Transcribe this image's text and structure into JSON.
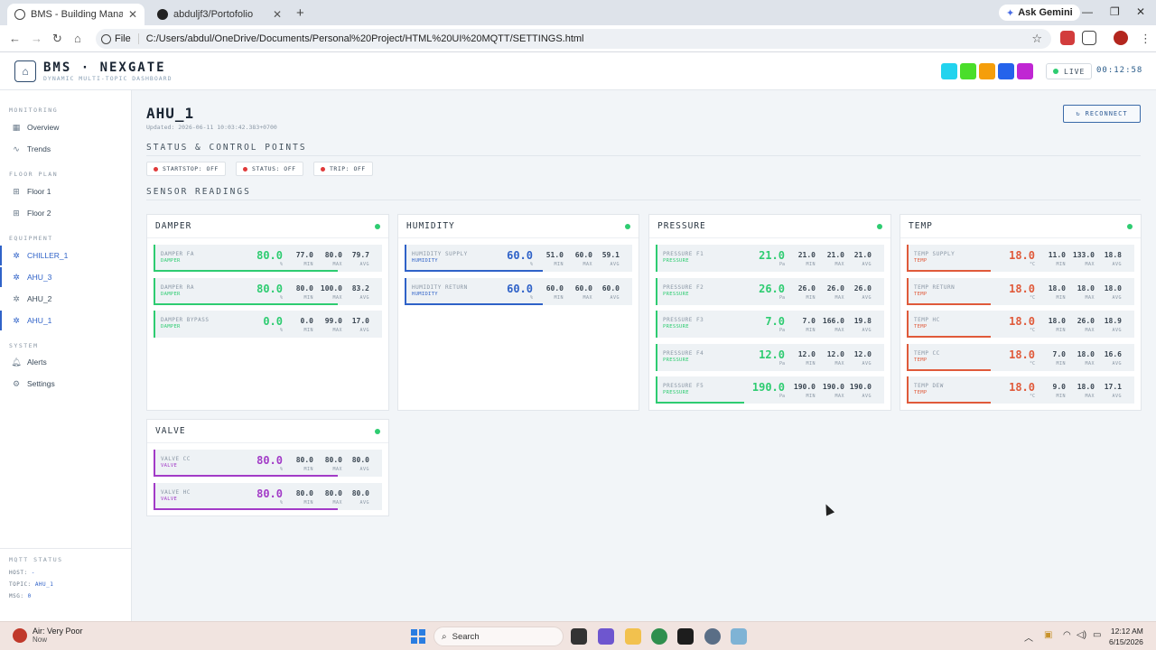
{
  "browser": {
    "tabs": [
      {
        "title": "BMS - Building Management Sy",
        "active": true
      },
      {
        "title": "abduljf3/Portofolio",
        "active": false
      }
    ],
    "ask_gemini": "Ask Gemini",
    "file_chip": "File",
    "url": "C:/Users/abdul/OneDrive/Documents/Personal%20Project/HTML%20UI%20MQTT/SETTINGS.html"
  },
  "header": {
    "brand": "BMS · NEXGATE",
    "subtitle": "DYNAMIC MULTI-TOPIC DASHBOARD",
    "swatches": [
      "#22d3ee",
      "#4ade2a",
      "#f59e0b",
      "#2563eb",
      "#c026d3"
    ],
    "live": "LIVE",
    "clock": "00:12:58"
  },
  "sidebar": {
    "sections": {
      "monitoring": "MONITORING",
      "floor_plan": "FLOOR PLAN",
      "equipment": "EQUIPMENT",
      "system": "SYSTEM"
    },
    "monitoring_items": [
      "Overview",
      "Trends"
    ],
    "floor_items": [
      "Floor 1",
      "Floor 2"
    ],
    "equipment_items": [
      "CHILLER_1",
      "AHU_3",
      "AHU_2",
      "AHU_1"
    ],
    "system_items": [
      "Alerts",
      "Settings"
    ],
    "mqtt": {
      "title": "MQTT STATUS",
      "host_label": "HOST:",
      "host": "-",
      "topic_label": "TOPIC:",
      "topic": "AHU_1",
      "msg_label": "MSG:",
      "msg": "0"
    }
  },
  "main": {
    "title": "AHU_1",
    "updated": "Updated: 2026-06-11 10:03:42.383+0700",
    "reconnect": "RECONNECT",
    "status_title": "STATUS & CONTROL POINTS",
    "status_chips": [
      "STARTSTOP: OFF",
      "STATUS: OFF",
      "TRIP: OFF"
    ],
    "sensor_title": "SENSOR READINGS",
    "stat_labels": {
      "min": "MIN",
      "max": "MAX",
      "avg": "AVG"
    }
  },
  "cards": [
    {
      "title": "DAMPER",
      "color": "#2ecc71",
      "rows": [
        {
          "name": "DAMPER FA",
          "type": "DAMPER",
          "value": "80.0",
          "unit": "%",
          "min": "77.0",
          "max": "80.0",
          "avg": "79.7",
          "level": 0.8
        },
        {
          "name": "DAMPER RA",
          "type": "DAMPER",
          "value": "80.0",
          "unit": "%",
          "min": "80.0",
          "max": "100.0",
          "avg": "83.2",
          "level": 0.8
        },
        {
          "name": "DAMPER BYPASS",
          "type": "DAMPER",
          "value": "0.0",
          "unit": "%",
          "min": "0.0",
          "max": "99.0",
          "avg": "17.0",
          "level": 0.0
        }
      ]
    },
    {
      "title": "HUMIDITY",
      "color": "#2f62c8",
      "rows": [
        {
          "name": "HUMIDITY SUPPLY",
          "type": "HUMIDITY",
          "value": "60.0",
          "unit": "%",
          "min": "51.0",
          "max": "60.0",
          "avg": "59.1",
          "level": 0.6
        },
        {
          "name": "HUMIDITY RETURN",
          "type": "HUMIDITY",
          "value": "60.0",
          "unit": "%",
          "min": "60.0",
          "max": "60.0",
          "avg": "60.0",
          "level": 0.6
        }
      ]
    },
    {
      "title": "PRESSURE",
      "color": "#2ecc71",
      "rows": [
        {
          "name": "PRESSURE F1",
          "type": "PRESSURE",
          "value": "21.0",
          "unit": "Pa",
          "min": "21.0",
          "max": "21.0",
          "avg": "21.0",
          "level": 0.0
        },
        {
          "name": "PRESSURE F2",
          "type": "PRESSURE",
          "value": "26.0",
          "unit": "Pa",
          "min": "26.0",
          "max": "26.0",
          "avg": "26.0",
          "level": 0.0
        },
        {
          "name": "PRESSURE F3",
          "type": "PRESSURE",
          "value": "7.0",
          "unit": "Pa",
          "min": "7.0",
          "max": "166.0",
          "avg": "19.8",
          "level": 0.0
        },
        {
          "name": "PRESSURE F4",
          "type": "PRESSURE",
          "value": "12.0",
          "unit": "Pa",
          "min": "12.0",
          "max": "12.0",
          "avg": "12.0",
          "level": 0.0
        },
        {
          "name": "PRESSURE F5",
          "type": "PRESSURE",
          "value": "190.0",
          "unit": "Pa",
          "min": "190.0",
          "max": "190.0",
          "avg": "190.0",
          "level": 0.38
        }
      ]
    },
    {
      "title": "TEMP",
      "color": "#e05a3a",
      "rows": [
        {
          "name": "TEMP SUPPLY",
          "type": "TEMP",
          "value": "18.0",
          "unit": "°C",
          "min": "11.0",
          "max": "133.0",
          "avg": "18.8",
          "level": 0.36
        },
        {
          "name": "TEMP RETURN",
          "type": "TEMP",
          "value": "18.0",
          "unit": "°C",
          "min": "18.0",
          "max": "18.0",
          "avg": "18.0",
          "level": 0.36
        },
        {
          "name": "TEMP HC",
          "type": "TEMP",
          "value": "18.0",
          "unit": "°C",
          "min": "18.0",
          "max": "26.0",
          "avg": "18.9",
          "level": 0.36
        },
        {
          "name": "TEMP CC",
          "type": "TEMP",
          "value": "18.0",
          "unit": "°C",
          "min": "7.0",
          "max": "18.0",
          "avg": "16.6",
          "level": 0.36
        },
        {
          "name": "TEMP DEW",
          "type": "TEMP",
          "value": "18.0",
          "unit": "°C",
          "min": "9.0",
          "max": "18.0",
          "avg": "17.1",
          "level": 0.36
        }
      ]
    },
    {
      "title": "VALVE",
      "color": "#a23bc7",
      "rows": [
        {
          "name": "VALVE CC",
          "type": "VALVE",
          "value": "80.0",
          "unit": "%",
          "min": "80.0",
          "max": "80.0",
          "avg": "80.0",
          "level": 0.8
        },
        {
          "name": "VALVE HC",
          "type": "VALVE",
          "value": "80.0",
          "unit": "%",
          "min": "80.0",
          "max": "80.0",
          "avg": "80.0",
          "level": 0.8
        }
      ]
    }
  ],
  "taskbar": {
    "weather_title": "Air: Very Poor",
    "weather_sub": "Now",
    "search": "Search",
    "time": "12:12 AM",
    "date": "6/15/2026"
  }
}
